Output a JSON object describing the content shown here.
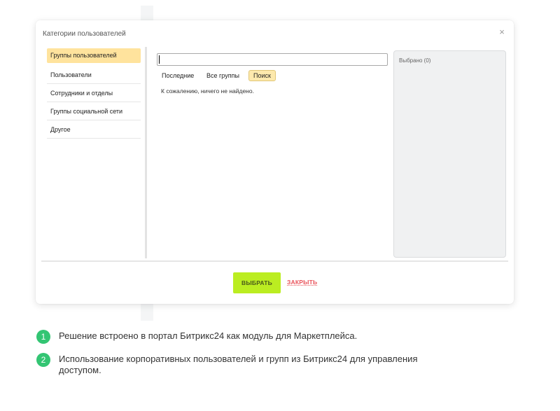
{
  "dialog": {
    "title": "Категории пользователей",
    "close_icon": "close-icon",
    "sidebar": {
      "items": [
        {
          "label": "Группы пользователей",
          "active": true
        },
        {
          "label": "Пользователи",
          "active": false
        },
        {
          "label": "Сотрудники и отделы",
          "active": false
        },
        {
          "label": "Группы социальной сети",
          "active": false
        },
        {
          "label": "Другое",
          "active": false
        }
      ]
    },
    "search": {
      "value": "",
      "placeholder": ""
    },
    "tabs": [
      {
        "label": "Последние",
        "active": false
      },
      {
        "label": "Все группы",
        "active": false
      },
      {
        "label": "Поиск",
        "active": true
      }
    ],
    "no_results_text": "К сожалению, ничего не найдено.",
    "selected_label": "Выбрано (0)",
    "buttons": {
      "select": "ВЫБРАТЬ",
      "close": "ЗАКРЫТЬ"
    }
  },
  "notes": [
    {
      "number": "1",
      "text": "Решение встроено в портал Битрикс24 как модуль для Маркетплейса."
    },
    {
      "number": "2",
      "text": "Использование корпоративных пользователей и групп из Битрикс24 для управления доступом."
    }
  ],
  "colors": {
    "accent_green": "#bbed21",
    "active_item_bg": "#ffe39d",
    "close_link": "#e9545b",
    "badge_green": "#33c573"
  }
}
